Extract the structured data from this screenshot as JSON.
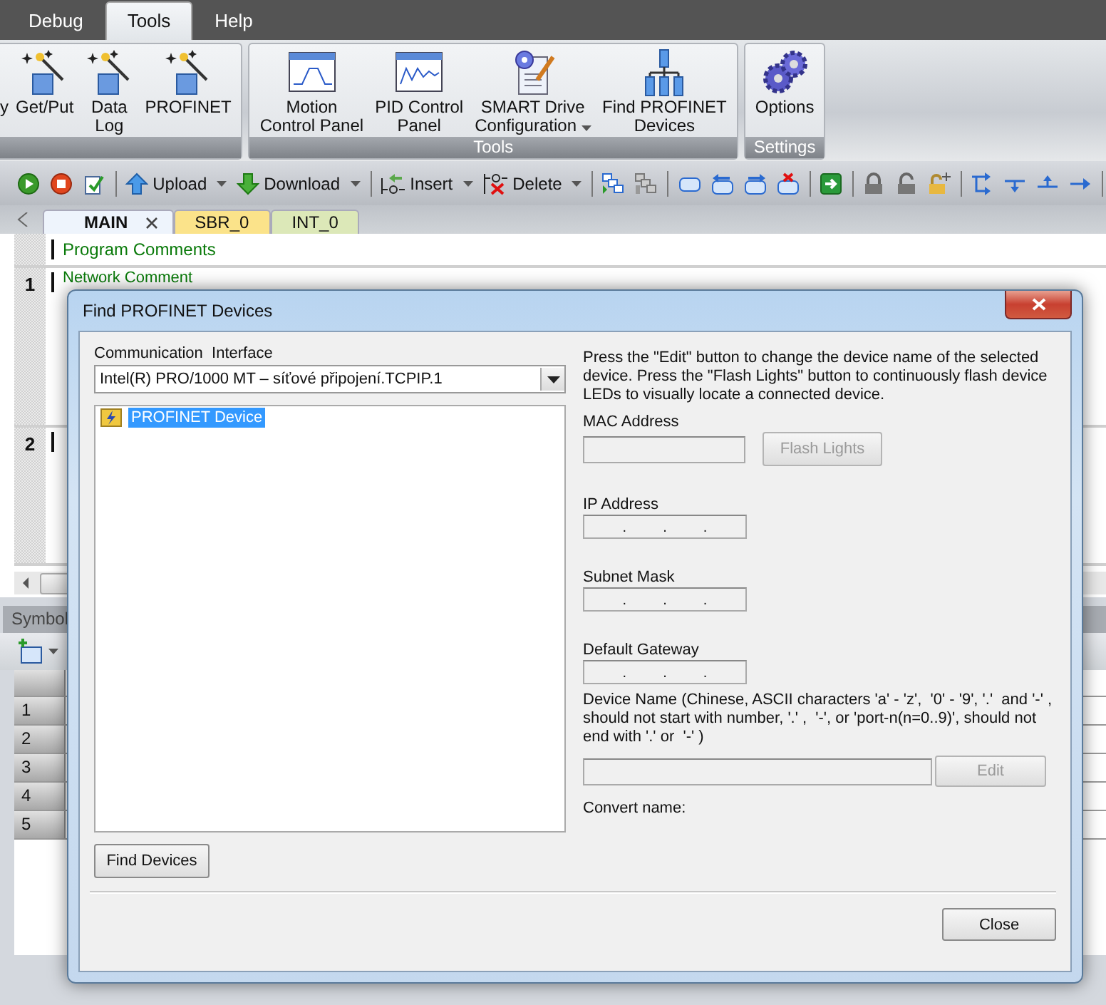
{
  "menu_tabs": [
    {
      "label": "Debug",
      "selected": false
    },
    {
      "label": "Tools",
      "selected": true
    },
    {
      "label": "Help",
      "selected": false
    }
  ],
  "ribbon_groups": [
    {
      "items": [
        {
          "kind": "partial",
          "label": "y"
        },
        {
          "kind": "wizard",
          "label": "Get/Put"
        },
        {
          "kind": "wizard",
          "label": "Data\nLog"
        },
        {
          "kind": "wizard",
          "label": "PROFINET"
        }
      ]
    },
    {
      "title": "Tools",
      "items": [
        {
          "kind": "curve",
          "label": "Motion\nControl Panel"
        },
        {
          "kind": "wave",
          "label": "PID Control\nPanel"
        },
        {
          "kind": "config",
          "label": "SMART Drive\nConfiguration",
          "dropdown": true
        },
        {
          "kind": "network",
          "label": "Find PROFINET\nDevices"
        }
      ]
    },
    {
      "title": "Settings",
      "items": [
        {
          "kind": "gears",
          "label": "Options"
        }
      ]
    }
  ],
  "toolbar": [
    {
      "kind": "run"
    },
    {
      "kind": "stop"
    },
    {
      "kind": "compile"
    },
    {
      "kind": "sep"
    },
    {
      "kind": "upload",
      "label": "Upload",
      "dropdown": true
    },
    {
      "kind": "download",
      "label": "Download",
      "dropdown": true
    },
    {
      "kind": "sep"
    },
    {
      "kind": "insert",
      "label": "Insert",
      "dropdown": true
    },
    {
      "kind": "delete",
      "label": "Delete",
      "dropdown": true
    },
    {
      "kind": "sep"
    },
    {
      "kind": "grid"
    },
    {
      "kind": "grid-grey"
    },
    {
      "kind": "sep"
    },
    {
      "kind": "block"
    },
    {
      "kind": "block-left"
    },
    {
      "kind": "block-right"
    },
    {
      "kind": "block-delete"
    },
    {
      "kind": "sep"
    },
    {
      "kind": "goto"
    },
    {
      "kind": "sep"
    },
    {
      "kind": "lock"
    },
    {
      "kind": "unlock"
    },
    {
      "kind": "unlock-add"
    },
    {
      "kind": "sep"
    },
    {
      "kind": "wire-branch"
    },
    {
      "kind": "wire-down"
    },
    {
      "kind": "wire-up"
    },
    {
      "kind": "wire-right"
    },
    {
      "kind": "sep"
    }
  ],
  "editor_tabs": [
    {
      "label": "MAIN",
      "selected": true,
      "color": "#eef4fc"
    },
    {
      "label": "SBR_0",
      "selected": false,
      "color": "#fbe38a"
    },
    {
      "label": "INT_0",
      "selected": false,
      "color": "#dce8b8"
    }
  ],
  "editor": {
    "program_comments": "Program Comments",
    "networks": [
      {
        "number": "1",
        "comment": "Network Comment"
      },
      {
        "number": "2"
      }
    ]
  },
  "symbol_panel": {
    "title": "Symbol",
    "rows": [
      "1",
      "2",
      "3",
      "4",
      "5"
    ]
  },
  "dialog": {
    "title": "Find PROFINET Devices",
    "interface_label": "Communication  Interface",
    "interface_value": "Intel(R) PRO/1000 MT – síťové připojení.TCPIP.1",
    "devices": [
      {
        "label": "PROFINET Device",
        "selected": true
      }
    ],
    "find_button": "Find Devices",
    "info": "Press the \"Edit\" button to change the device name of the selected device. Press the \"Flash Lights\" button to continuously flash device LEDs to visually locate a connected device.",
    "fields": [
      {
        "kind": "text",
        "label": "MAC Address",
        "button": {
          "label": "Flash Lights",
          "disabled": true
        }
      },
      {
        "kind": "ip",
        "label": "IP Address",
        "separators": [
          ".",
          ".",
          "."
        ]
      },
      {
        "kind": "ip",
        "label": "Subnet Mask",
        "separators": [
          ".",
          ".",
          "."
        ]
      },
      {
        "kind": "ip",
        "label": "Default Gateway",
        "separators": [
          ".",
          ".",
          "."
        ]
      }
    ],
    "device_name_label": "Device Name (Chinese, ASCII characters 'a' - 'z',  '0' - '9', '.'  and '-' , should not start with number, '.' ,  '-', or 'port-n(n=0..9)', should not end with '.' or  '-' )",
    "edit_button": {
      "label": "Edit",
      "disabled": true
    },
    "convert_label": "Convert name:",
    "close_button": "Close"
  }
}
